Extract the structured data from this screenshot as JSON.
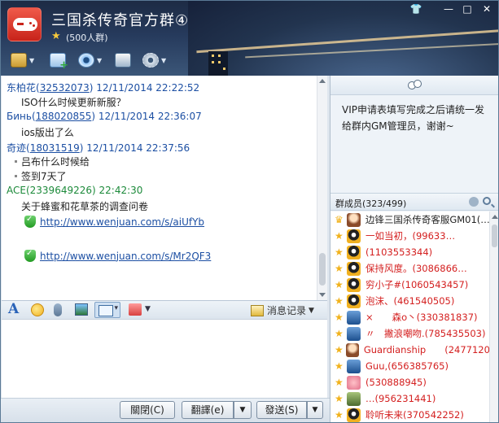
{
  "window": {
    "title": "三国杀传奇官方群④",
    "member_count": "(500人群)"
  },
  "toolbar": {
    "icons": [
      "folder-icon",
      "add-app-icon",
      "video-icon",
      "announcement-icon",
      "settings-icon"
    ]
  },
  "messages": [
    {
      "name": "东柏花",
      "uid": "32532073",
      "time": "12/11/2014 22:22:52",
      "lines": [
        "ISO什么时候更新新服？"
      ]
    },
    {
      "name": "Бинь",
      "uid": "188020855",
      "time": "12/11/2014 22:36:07",
      "lines": [
        "ios版出了么"
      ]
    },
    {
      "name": "奇迹",
      "uid": "18031519",
      "time": "12/11/2014 22:37:56",
      "lines": [
        "吕布什么时候给",
        "签到7天了"
      ]
    },
    {
      "name": "ACE",
      "uid": "2339649226",
      "time": "22:42:30",
      "lines": [
        "关于蜂蜜和花草茶的调查问卷"
      ],
      "links": [
        "http://www.wenjuan.com/s/aiUfYb",
        "http://www.wenjuan.com/s/Mr2QF3"
      ]
    }
  ],
  "input_toolbar": {
    "history_label": "消息记录"
  },
  "buttons": {
    "close": "關閉(C)",
    "translate": "翻譯(e)",
    "send": "發送(S)"
  },
  "notice": {
    "text": "VIP申请表填写完成之后请统一发给群内GM管理员，谢谢~"
  },
  "members": {
    "header": "群成员(323/499)",
    "items": [
      {
        "name": "边锋三国杀传奇客服GM01(…",
        "color": "#222222",
        "avatar": "av-girl",
        "star": false
      },
      {
        "name": "一如当初，(99633…",
        "color": "#d42020",
        "avatar": "av-qq",
        "star": true
      },
      {
        "name": "(1103553344)",
        "color": "#d42020",
        "avatar": "av-qq",
        "star": true
      },
      {
        "name": "保持风度。(3086866…",
        "color": "#d42020",
        "avatar": "av-qq",
        "star": true
      },
      {
        "name": "穷小子#(1060543457)",
        "color": "#d42020",
        "avatar": "av-qq",
        "star": true
      },
      {
        "name": "泡沫、(461540505)",
        "color": "#d42020",
        "avatar": "av-qq",
        "star": true
      },
      {
        "name": "×　　森o丶(330381837)",
        "color": "#d42020",
        "avatar": "av-blue",
        "star": true
      },
      {
        "name": "〃　撇浪嘲吻.(785435503)",
        "color": "#d42020",
        "avatar": "av-blue",
        "star": true
      },
      {
        "name": "Guardianship　　(2477120…",
        "color": "#d42020",
        "avatar": "av-girl",
        "star": true
      },
      {
        "name": "Guu,(656385765)",
        "color": "#d42020",
        "avatar": "av-blue",
        "star": true
      },
      {
        "name": "(530888945)",
        "color": "#d42020",
        "avatar": "av-pig",
        "star": true
      },
      {
        "name": "…(956231441)",
        "color": "#d42020",
        "avatar": "av-img",
        "star": true
      },
      {
        "name": "聆听未来(370542252)",
        "color": "#d42020",
        "avatar": "av-qq",
        "star": true
      }
    ]
  }
}
